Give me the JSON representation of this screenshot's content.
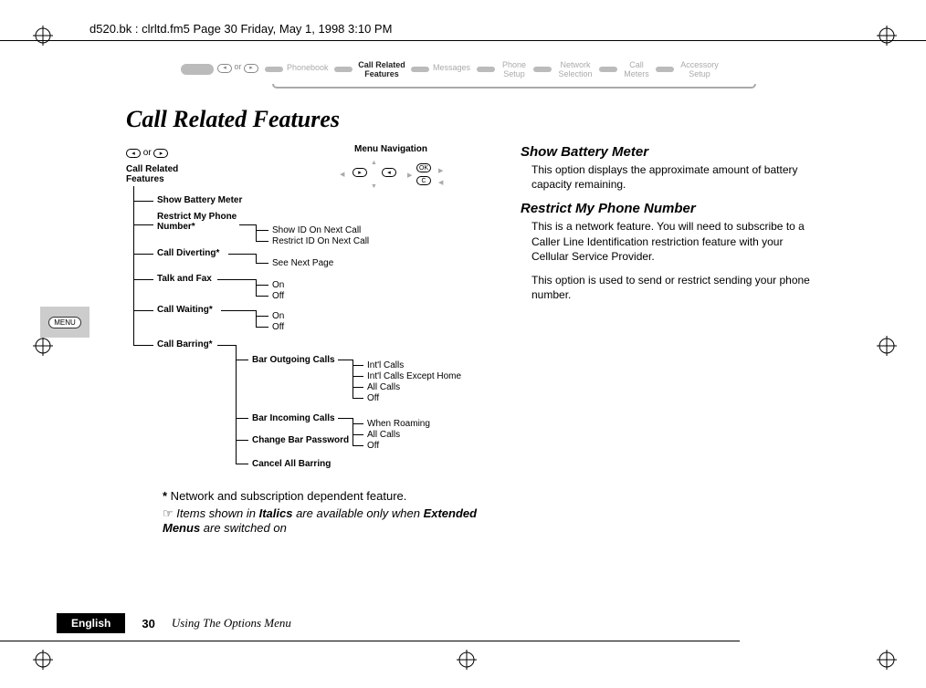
{
  "header_path": "d520.bk : clrltd.fm5  Page 30  Friday, May 1, 1998  3:10 PM",
  "breadcrumb": {
    "or_label": "or",
    "items": [
      "Phonebook",
      "Call Related Features",
      "Messages",
      "Phone Setup",
      "Network Selection",
      "Call Meters",
      "Accessory Setup"
    ],
    "active_index": 1
  },
  "title": "Call Related Features",
  "diagram": {
    "or_label": "or",
    "root": "Call Related Features",
    "nav_title": "Menu Navigation",
    "nav_keys": {
      "ok": "OK",
      "c": "C"
    },
    "items": [
      {
        "label": "Show Battery Meter"
      },
      {
        "label": "Restrict My Phone Number*",
        "children": [
          "Show ID On Next Call",
          "Restrict ID On Next Call"
        ]
      },
      {
        "label": "Call Diverting*",
        "children": [
          "See Next Page"
        ]
      },
      {
        "label": "Talk and Fax",
        "children": [
          "On",
          "Off"
        ]
      },
      {
        "label": "Call Waiting*",
        "children": [
          "On",
          "Off"
        ]
      },
      {
        "label": "Call Barring*",
        "children": [
          {
            "label": "Bar Outgoing Calls",
            "children": [
              "Int'l Calls",
              "Int'l Calls Except Home",
              "All Calls",
              "Off"
            ]
          },
          {
            "label": "Bar Incoming Calls",
            "children": [
              "When Roaming",
              "All Calls",
              "Off"
            ]
          },
          {
            "label": "Change Bar Password"
          },
          {
            "label": "Cancel All Barring"
          }
        ]
      }
    ]
  },
  "notes": {
    "star_prefix": "*",
    "star_text": " Network and subscription dependent feature.",
    "hand_symbol": "☞",
    "hand_before": "Items shown in ",
    "hand_bold1": "Italics",
    "hand_mid": " are available only when ",
    "hand_bold2": "Extended Menus",
    "hand_after": " are switched on"
  },
  "right": {
    "h1": "Show Battery Meter",
    "p1": "This option displays the approximate amount of battery capacity remaining.",
    "h2": "Restrict My Phone Number",
    "p2": "This is a network feature. You will need to subscribe to a Caller Line Identification restriction feature with your Cellular Service Provider.",
    "p3": "This option is used to send or restrict sending your phone number."
  },
  "side_tab": "MENU",
  "footer": {
    "lang": "English",
    "page": "30",
    "section": "Using The Options Menu"
  }
}
